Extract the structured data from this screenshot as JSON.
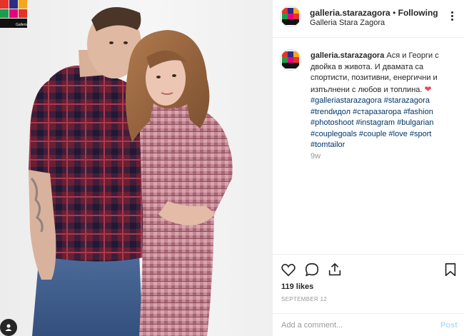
{
  "post": {
    "username": "galleria.starazagora",
    "separator": "•",
    "follow_status": "Following",
    "location": "Galleria Stara Zagora",
    "caption_text": "Ася и Георги с двойка в живота. И двамата са спортисти, позитивни, енергични и изпълнени с любов и топлина.",
    "caption_emoji": "❤",
    "hashtags": [
      "#galleriastarazagora",
      "#starazagora",
      "#trendидол",
      "#старазагора",
      "#fashion",
      "#photoshoot",
      "#instagram",
      "#bulgarian",
      "#couplegoals",
      "#couple",
      "#love",
      "#sport",
      "#tomtailor"
    ],
    "time_ago": "9w",
    "likes": "119 likes",
    "date": "SEPTEMBER 12",
    "comment_placeholder": "Add a comment...",
    "post_label": "Post"
  },
  "photo_logo": {
    "label": "Galleria",
    "colors": [
      "#e63329",
      "#2b2e83",
      "#f6a81c",
      "#1b9e4b",
      "#e6007e",
      "#111111"
    ]
  },
  "icons": {
    "more": "more-options-icon",
    "like": "heart-icon",
    "comment": "comment-icon",
    "share": "share-icon",
    "save": "bookmark-icon"
  },
  "colors": {
    "link": "#003569",
    "muted": "#999999",
    "heart": "#ed4956",
    "post_disabled": "#b2dffc"
  }
}
